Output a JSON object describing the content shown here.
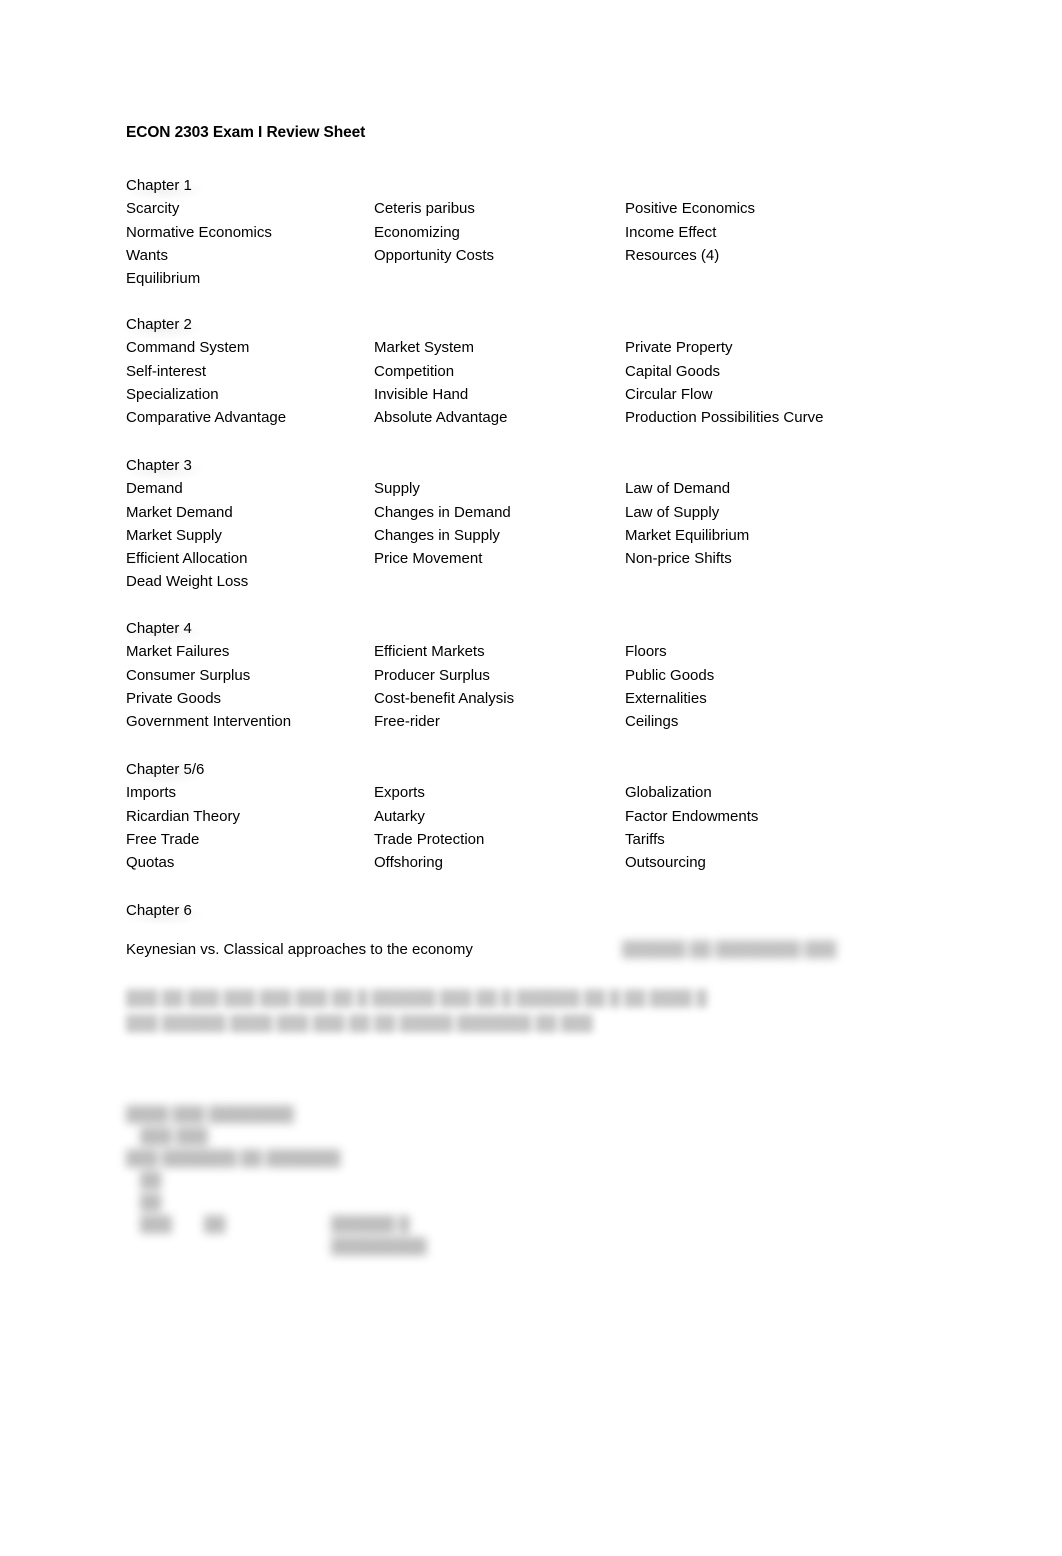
{
  "document": {
    "title": "ECON 2303 Exam I Review Sheet"
  },
  "chapters": [
    {
      "heading": "Chapter 1",
      "rows": [
        {
          "col1": "Scarcity",
          "col2": "Ceteris paribus",
          "col3": "Positive Economics"
        },
        {
          "col1": "Normative Economics",
          "col2": "Economizing",
          "col3": "Income Effect"
        },
        {
          "col1": "Wants",
          "col2": "Opportunity Costs",
          "col3": "Resources (4)"
        },
        {
          "col1": "Equilibrium",
          "col2": "",
          "col3": ""
        }
      ]
    },
    {
      "heading": "Chapter 2",
      "rows": [
        {
          "col1": "Command System",
          "col2": "Market System",
          "col3": "Private Property"
        },
        {
          "col1": "Self-interest",
          "col2": "Competition",
          "col3": "Capital Goods"
        },
        {
          "col1": "Specialization",
          "col2": "Invisible Hand",
          "col3": "Circular Flow"
        },
        {
          "col1": "Comparative Advantage",
          "col2": "Absolute Advantage",
          "col3": "Production Possibilities Curve"
        }
      ]
    },
    {
      "heading": "Chapter 3",
      "rows": [
        {
          "col1": "Demand",
          "col2": "Supply",
          "col3": "Law of Demand"
        },
        {
          "col1": "Market Demand",
          "col2": "Changes in Demand",
          "col3": "Law of Supply"
        },
        {
          "col1": "Market Supply",
          "col2": "Changes in Supply",
          "col3": "Market Equilibrium"
        },
        {
          "col1": "Efficient Allocation",
          "col2": "Price Movement",
          "col3": "Non-price Shifts"
        },
        {
          "col1": "Dead Weight Loss",
          "col2": "",
          "col3": ""
        }
      ]
    },
    {
      "heading": "Chapter 4",
      "rows": [
        {
          "col1": "Market Failures",
          "col2": "Efficient Markets",
          "col3": "Floors"
        },
        {
          "col1": "Consumer Surplus",
          "col2": "Producer Surplus",
          "col3": "Public Goods"
        },
        {
          "col1": "Private Goods",
          "col2": "Cost-benefit Analysis",
          "col3": "Externalities"
        },
        {
          "col1": "Government Intervention",
          "col2": "Free-rider",
          "col3": "Ceilings"
        }
      ]
    },
    {
      "heading": "Chapter 5/6",
      "rows": [
        {
          "col1": "Imports",
          "col2": "Exports",
          "col3": "Globalization"
        },
        {
          "col1": "Ricardian Theory",
          "col2": "Autarky",
          "col3": "Factor Endowments"
        },
        {
          "col1": "Free Trade",
          "col2": "Trade Protection",
          "col3": "Tariffs"
        },
        {
          "col1": "Quotas",
          "col2": "Offshoring",
          "col3": "Outsourcing"
        }
      ]
    },
    {
      "heading": "Chapter 6",
      "rows": []
    }
  ],
  "chapter6": {
    "line": "Keynesian vs. Classical approaches to the economy",
    "redacted_note": "██████ ██ ████████ ███"
  },
  "redacted_paragraph": {
    "line1": "███ ██ ███ ███ ███ ███ ██ █ ██████ ███ ██ █ ██████ ██ █ ██ ████ █",
    "line2": "███ ██████  ████ ███ ███ ██ ██ █████ ███████ ██ ███"
  },
  "redacted_block": {
    "line1": "████ ███ ████████",
    "line2": "███ ███",
    "line3": "███ ███████ ██ ███████",
    "line4": "██",
    "line5": "██",
    "row_a": "███",
    "row_b": "██",
    "row_c": "██████  █  █████████"
  }
}
